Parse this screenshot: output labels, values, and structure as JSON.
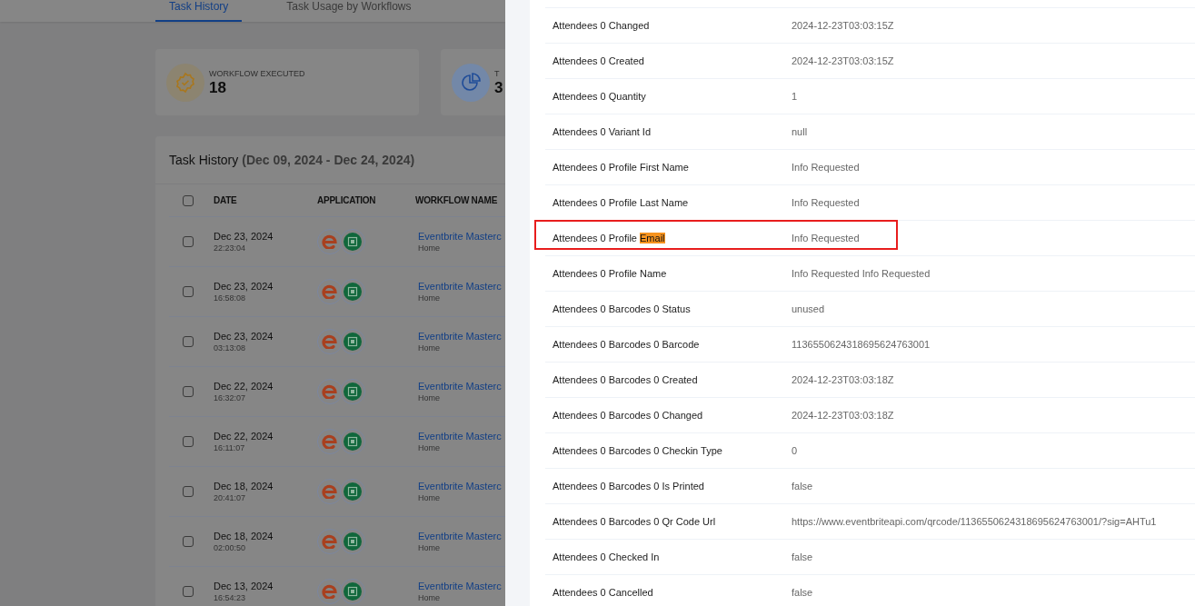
{
  "tabs": [
    {
      "label": "Task History",
      "selected": true
    },
    {
      "label": "Task Usage by Workflows",
      "selected": false
    }
  ],
  "stats": [
    {
      "kind": "badge",
      "label": "WORKFLOW EXECUTED",
      "value": "18"
    },
    {
      "kind": "pie",
      "label": "T",
      "value": "3"
    }
  ],
  "task_history": {
    "title": "Task History",
    "range": "(Dec 09, 2024 - Dec 24, 2024)",
    "select_all": {
      "checked": false
    },
    "columns": [
      "DATE",
      "APPLICATION",
      "WORKFLOW NAME"
    ],
    "rows": [
      {
        "date": "Dec 23, 2024",
        "time": "22:23:04",
        "workflow": "Eventbrite Masterc",
        "folder": "Home",
        "checked": false
      },
      {
        "date": "Dec 23, 2024",
        "time": "16:58:08",
        "workflow": "Eventbrite Masterc",
        "folder": "Home",
        "checked": false
      },
      {
        "date": "Dec 23, 2024",
        "time": "03:13:08",
        "workflow": "Eventbrite Masterc",
        "folder": "Home",
        "checked": false
      },
      {
        "date": "Dec 22, 2024",
        "time": "16:32:07",
        "workflow": "Eventbrite Masterc",
        "folder": "Home",
        "checked": false
      },
      {
        "date": "Dec 22, 2024",
        "time": "16:11:07",
        "workflow": "Eventbrite Masterc",
        "folder": "Home",
        "checked": false
      },
      {
        "date": "Dec 18, 2024",
        "time": "20:41:07",
        "workflow": "Eventbrite Masterc",
        "folder": "Home",
        "checked": false
      },
      {
        "date": "Dec 18, 2024",
        "time": "02:00:50",
        "workflow": "Eventbrite Masterc",
        "folder": "Home",
        "checked": false
      },
      {
        "date": "Dec 13, 2024",
        "time": "16:54:23",
        "workflow": "Eventbrite Masterc",
        "folder": "Home",
        "checked": false
      }
    ]
  },
  "detail_rows": [
    {
      "label": "Attendees 0 Changed",
      "value": "2024-12-23T03:03:15Z",
      "outlined": false
    },
    {
      "label": "Attendees 0 Created",
      "value": "2024-12-23T03:03:15Z",
      "outlined": false
    },
    {
      "label": "Attendees 0 Quantity",
      "value": "1",
      "outlined": false
    },
    {
      "label": "Attendees 0 Variant Id",
      "value": "null",
      "outlined": false
    },
    {
      "label": "Attendees 0 Profile First Name",
      "value": "Info Requested",
      "outlined": false
    },
    {
      "label": "Attendees 0 Profile Last Name",
      "value": "Info Requested",
      "outlined": false
    },
    {
      "label": "Attendees 0 Profile ",
      "highlight": "Email",
      "value": "Info Requested",
      "outlined": true
    },
    {
      "label": "Attendees 0 Profile Name",
      "value": "Info Requested Info Requested",
      "outlined": false
    },
    {
      "label": "Attendees 0 Barcodes 0 Status",
      "value": "unused",
      "outlined": false
    },
    {
      "label": "Attendees 0 Barcodes 0 Barcode",
      "value": "1136550624318695624763001",
      "outlined": false
    },
    {
      "label": "Attendees 0 Barcodes 0 Created",
      "value": "2024-12-23T03:03:18Z",
      "outlined": false
    },
    {
      "label": "Attendees 0 Barcodes 0 Changed",
      "value": "2024-12-23T03:03:18Z",
      "outlined": false
    },
    {
      "label": "Attendees 0 Barcodes 0 Checkin Type",
      "value": "0",
      "outlined": false
    },
    {
      "label": "Attendees 0 Barcodes 0 Is Printed",
      "value": "false",
      "outlined": false
    },
    {
      "label": "Attendees 0 Barcodes 0 Qr Code Url",
      "value": "https://www.eventbriteapi.com/qrcode/1136550624318695624763001/?sig=AHTu1",
      "outlined": false
    },
    {
      "label": "Attendees 0 Checked In",
      "value": "false",
      "outlined": false
    },
    {
      "label": "Attendees 0 Cancelled",
      "value": "false",
      "outlined": false
    }
  ]
}
